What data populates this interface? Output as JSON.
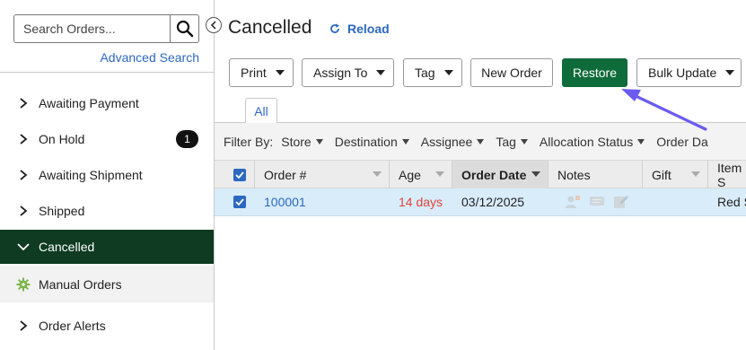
{
  "sidebar": {
    "search_placeholder": "Search Orders...",
    "advanced_search": "Advanced Search",
    "items": [
      {
        "label": "Awaiting Payment"
      },
      {
        "label": "On Hold",
        "badge": "1"
      },
      {
        "label": "Awaiting Shipment"
      },
      {
        "label": "Shipped"
      },
      {
        "label": "Cancelled"
      },
      {
        "label": "Manual Orders"
      },
      {
        "label": "Order Alerts"
      }
    ]
  },
  "header": {
    "title": "Cancelled",
    "reload": "Reload"
  },
  "toolbar": {
    "print": "Print",
    "assign_to": "Assign To",
    "tag": "Tag",
    "new_order": "New Order",
    "restore": "Restore",
    "bulk_update": "Bulk Update"
  },
  "tabs": {
    "all": "All"
  },
  "filters": {
    "label": "Filter By:",
    "items": [
      "Store",
      "Destination",
      "Assignee",
      "Tag",
      "Allocation Status",
      "Order Da"
    ]
  },
  "grid": {
    "columns": [
      "Order #",
      "Age",
      "Order Date",
      "Notes",
      "Gift",
      "Item S"
    ],
    "rows": [
      {
        "order": "100001",
        "age": "14 days",
        "order_date": "03/12/2025",
        "notes": "",
        "gift": "",
        "item": "Red S"
      }
    ]
  },
  "colors": {
    "accent": "#2c68c0",
    "active_nav": "#0e3b22",
    "restore": "#0e6b3a",
    "age_text": "#e0453a",
    "selected_row": "#d8ecfa",
    "annotation_arrow": "#6a5cf0"
  }
}
